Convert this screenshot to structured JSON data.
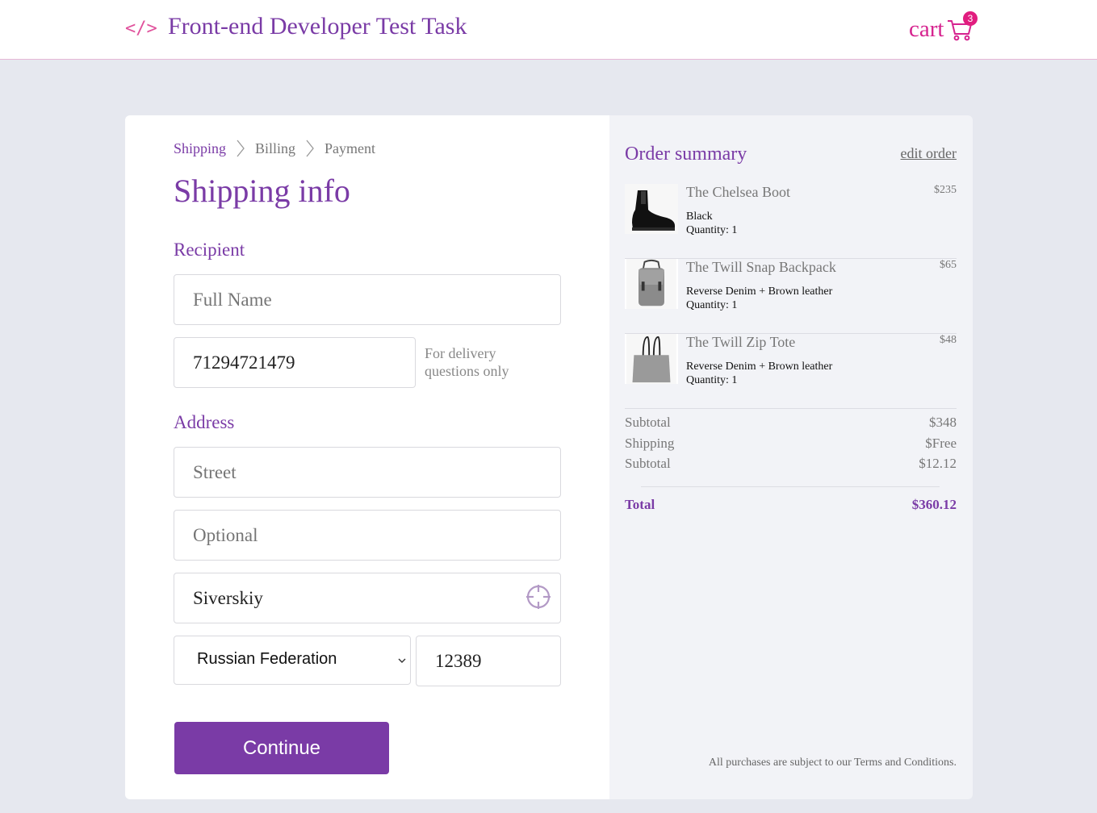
{
  "header": {
    "logo_glyph": "</>",
    "title": "Front-end Developer Test Task",
    "cart_label": "cart",
    "cart_count": "3"
  },
  "breadcrumb": [
    {
      "label": "Shipping",
      "active": true
    },
    {
      "label": "Billing",
      "active": false
    },
    {
      "label": "Payment",
      "active": false
    }
  ],
  "form": {
    "title": "Shipping info",
    "recipient_label": "Recipient",
    "full_name_placeholder": "Full Name",
    "phone_value": "71294721479",
    "phone_note": "For delivery questions only",
    "address_label": "Address",
    "street_placeholder": "Street",
    "optional_placeholder": "Optional",
    "city_value": "Siverskiy",
    "country_selected": "Russian Federation",
    "zip_value": "12389",
    "continue_label": "Continue"
  },
  "summary": {
    "title": "Order summary",
    "edit_label": "edit order",
    "items": [
      {
        "name": "The Chelsea Boot",
        "price": "$235",
        "variant": "Black",
        "quantity": "Quantity: 1",
        "icon": "boot-thumbnail"
      },
      {
        "name": "The Twill Snap Backpack",
        "price": "$65",
        "variant": "Reverse Denim + Brown leather",
        "quantity": "Quantity: 1",
        "icon": "backpack-thumbnail"
      },
      {
        "name": "The Twill Zip Tote",
        "price": "$48",
        "variant": "Reverse Denim + Brown leather",
        "quantity": "Quantity: 1",
        "icon": "tote-thumbnail"
      }
    ],
    "totals": [
      {
        "label": "Subtotal",
        "value": "$348"
      },
      {
        "label": "Shipping",
        "value": "$Free"
      },
      {
        "label": "Subtotal",
        "value": "$12.12"
      }
    ],
    "total_label": "Total",
    "total_value": "$360.12",
    "terms": "All purchases are subject to our Terms and Conditions."
  },
  "colors": {
    "accent": "#7a3ba6",
    "cart_pink": "#d6238f",
    "page_bg": "#e6e8ef"
  }
}
